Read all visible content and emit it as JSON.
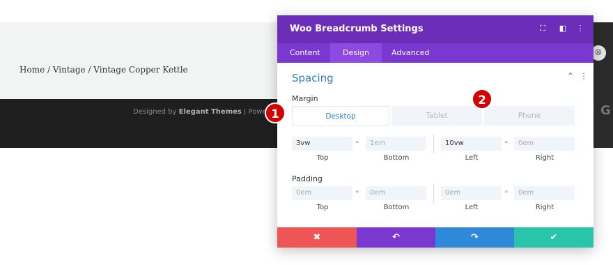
{
  "page": {
    "breadcrumb": "Home / Vintage / Vintage Copper Kettle",
    "footer_prefix": "Designed by ",
    "footer_brand": "Elegant Themes",
    "footer_suffix": " | Powere",
    "side_letter": "G"
  },
  "modal": {
    "title": "Woo Breadcrumb Settings",
    "header_icons": [
      "focus-icon",
      "split-view-icon",
      "more-icon"
    ],
    "tabs": [
      {
        "label": "Content",
        "active": false
      },
      {
        "label": "Design",
        "active": true
      },
      {
        "label": "Advanced",
        "active": false
      }
    ],
    "section_title": "Spacing",
    "margin_label": "Margin",
    "padding_label": "Padding",
    "device_tabs": [
      "Desktop",
      "Tablet",
      "Phone"
    ],
    "margin": {
      "top": {
        "value": "3vw",
        "label": "Top"
      },
      "bottom": {
        "placeholder": "1em",
        "label": "Bottom"
      },
      "left": {
        "value": "10vw",
        "label": "Left"
      },
      "right": {
        "placeholder": "0em",
        "label": "Right"
      }
    },
    "padding": {
      "top": {
        "placeholder": "0em",
        "label": "Top"
      },
      "bottom": {
        "placeholder": "0em",
        "label": "Bottom"
      },
      "left": {
        "placeholder": "0em",
        "label": "Left"
      },
      "right": {
        "placeholder": "0em",
        "label": "Right"
      }
    },
    "footer_buttons": [
      {
        "name": "cancel",
        "glyph": "✖",
        "color": "#ef5555"
      },
      {
        "name": "undo",
        "glyph": "↶",
        "color": "#7b38d0"
      },
      {
        "name": "redo",
        "glyph": "↷",
        "color": "#2e8ad8"
      },
      {
        "name": "save",
        "glyph": "✔",
        "color": "#29c4a9"
      }
    ]
  },
  "annotations": [
    "1",
    "2"
  ],
  "colors": {
    "header": "#6c2eb9",
    "tabs": "#7b38d0",
    "accent": "#2e7fc1",
    "badge": "#d40000"
  }
}
